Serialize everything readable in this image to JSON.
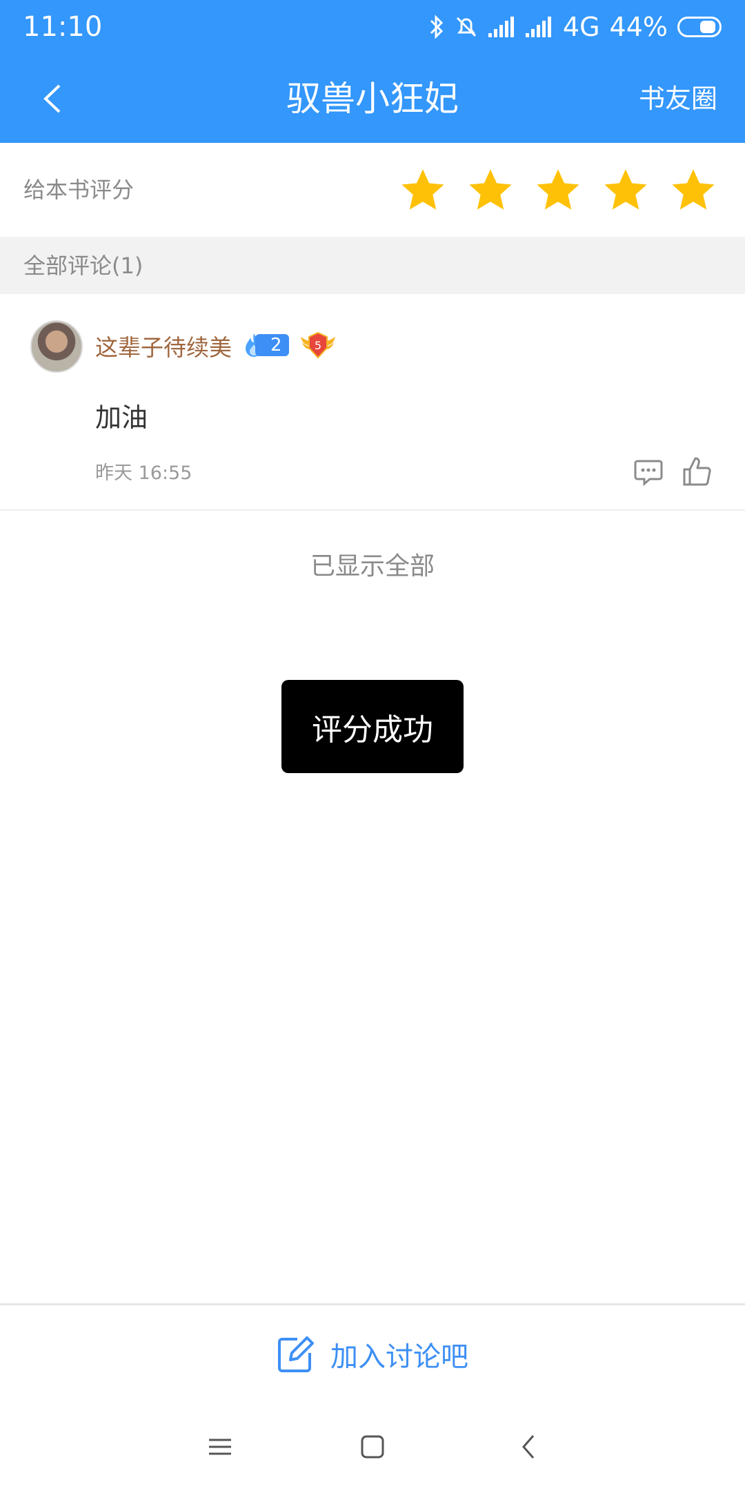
{
  "status_bar": {
    "time": "11:10",
    "network": "4G",
    "battery_percent": "44%",
    "icons": [
      "bluetooth-icon",
      "mute-icon",
      "signal-icon",
      "signal-icon"
    ]
  },
  "header": {
    "title": "驭兽小狂妃",
    "right_link": "书友圈",
    "back_icon": "chevron-left-icon",
    "background_color": "#3397fb"
  },
  "rating": {
    "label": "给本书评分",
    "stars_total": 5,
    "stars_selected": 5,
    "star_color": "#ffc107"
  },
  "comments_section": {
    "title": "全部评论(1)",
    "comments": [
      {
        "username": "这辈子待续美",
        "fire_level": "2",
        "medal_level": "5",
        "text": "加油",
        "time": "昨天 16:55"
      }
    ],
    "end_text": "已显示全部"
  },
  "toast": {
    "text": "评分成功"
  },
  "join_bar": {
    "label": "加入讨论吧",
    "accent_color": "#3d8ff5"
  }
}
